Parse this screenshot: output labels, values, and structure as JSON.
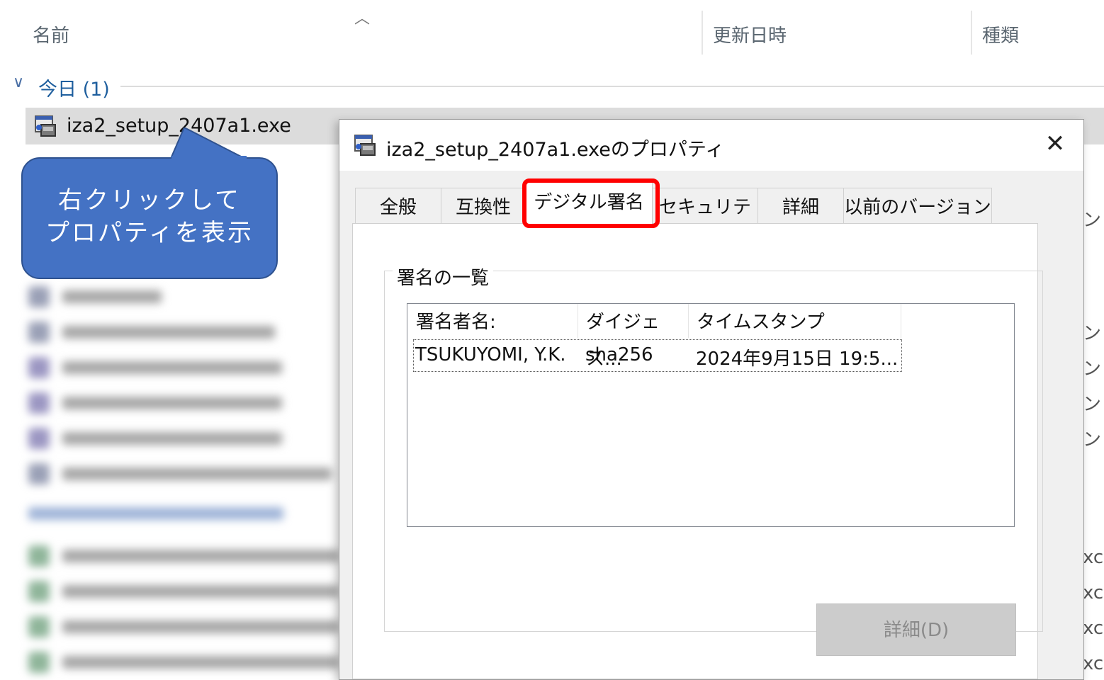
{
  "explorer": {
    "columns": {
      "name": "名前",
      "modified": "更新日時",
      "type": "種類"
    },
    "group": {
      "label": "今日 (1)"
    },
    "selected_file": {
      "name": "iza2_setup_2407a1.exe",
      "type_fragment": "ア ン"
    },
    "right_fragments": [
      "ン",
      "ン",
      "ン",
      "ン",
      "ン",
      "xce",
      "xce",
      "xce",
      "xce"
    ]
  },
  "callout": {
    "line1": "右クリックして",
    "line2": "プロパティを表示",
    "color": "#4472c4"
  },
  "dialog": {
    "title": "iza2_setup_2407a1.exeのプロパティ",
    "close_glyph": "✕",
    "tabs": [
      {
        "label": "全般"
      },
      {
        "label": "互換性"
      },
      {
        "label": "デジタル署名",
        "active": true
      },
      {
        "label": "セキュリティ"
      },
      {
        "label": "詳細"
      },
      {
        "label": "以前のバージョン"
      }
    ],
    "signature_group": {
      "legend": "署名の一覧",
      "headers": [
        "署名者名:",
        "ダイジェス...",
        "タイムスタンプ"
      ],
      "rows": [
        {
          "signer": "TSUKUYOMI, Y.K.",
          "digest": "sha256",
          "timestamp": "2024年9月15日 19:5..."
        }
      ]
    },
    "details_button": "詳細(D)",
    "highlight_color": "#ff0000"
  }
}
